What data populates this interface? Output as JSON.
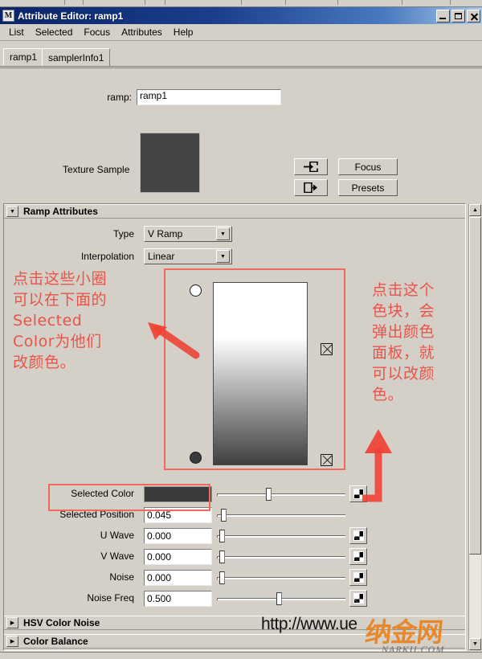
{
  "window": {
    "title": "Attribute Editor: ramp1",
    "icon": "maya-m-icon",
    "buttons": {
      "minimize": "minimize",
      "maximize": "maximize",
      "close": "close"
    }
  },
  "menubar": {
    "items": [
      "List",
      "Selected",
      "Focus",
      "Attributes",
      "Help"
    ]
  },
  "tabs": [
    {
      "label": "ramp1",
      "selected": true
    },
    {
      "label": "samplerInfo1",
      "selected": false
    }
  ],
  "upper": {
    "ramp_label": "ramp:",
    "ramp_value": "ramp1",
    "ramp_placeholder": "",
    "btn_in": "input-connection-icon",
    "btn_out": "output-connection-icon",
    "btn_focus": "Focus",
    "btn_presets": "Presets",
    "texture_sample_label": "Texture Sample",
    "texture_sample_color": "#454545"
  },
  "sections": {
    "ramp_attributes": {
      "title": "Ramp Attributes",
      "expanded": true,
      "type_label": "Type",
      "type_value": "V Ramp",
      "interpolation_label": "Interpolation",
      "interpolation_value": "Linear",
      "gradient_top_color": "#ffffff",
      "gradient_bottom_color": "#3f3f3f",
      "markers": [
        {
          "name": "ramp-marker-top",
          "color": "#ffffff",
          "position": 0.955
        },
        {
          "name": "ramp-marker-bottom",
          "color": "#3a3a3a",
          "position": 0.045
        }
      ],
      "rows": [
        {
          "label": "Selected Color",
          "kind": "color",
          "value": "#3a3a3a",
          "slider": 0.4
        },
        {
          "label": "Selected Position",
          "kind": "number",
          "value": "0.045",
          "slider": 0.03
        },
        {
          "label": "U Wave",
          "kind": "number",
          "value": "0.000",
          "slider": 0.02
        },
        {
          "label": "V Wave",
          "kind": "number",
          "value": "0.000",
          "slider": 0.02
        },
        {
          "label": "Noise",
          "kind": "number",
          "value": "0.000",
          "slider": 0.02
        },
        {
          "label": "Noise Freq",
          "kind": "number",
          "value": "0.500",
          "slider": 0.49
        }
      ]
    },
    "hsv_color_noise": {
      "title": "HSV Color Noise",
      "expanded": false
    },
    "color_balance": {
      "title": "Color Balance",
      "expanded": false
    }
  },
  "annotations": {
    "accent_color": "#e8544a",
    "left_text": "点击这些小圈\n可以在下面的\nSelected\nColor为他们\n改颜色。",
    "right_text": "点击这个\n色块，会\n弹出颜色\n面板，就\n可以改颜\n色。",
    "left_arrow": "arrow-pointing-upper-left",
    "right_arrow": "arrow-pointing-up",
    "highlight_ramp_box": "ramp-gradient-highlight",
    "highlight_selected_color_box": "selected-color-highlight"
  },
  "watermark": {
    "url": "http://www.ue",
    "logo_cn": "纳金网",
    "logo_domain": "NARKII.COM",
    "logo_color": "#e8821e"
  },
  "scrollbar": {
    "up": "▲",
    "down": "▼"
  },
  "glyphs": {
    "collapsed": "▶",
    "expanded": "▼",
    "combo_down": "▼"
  }
}
